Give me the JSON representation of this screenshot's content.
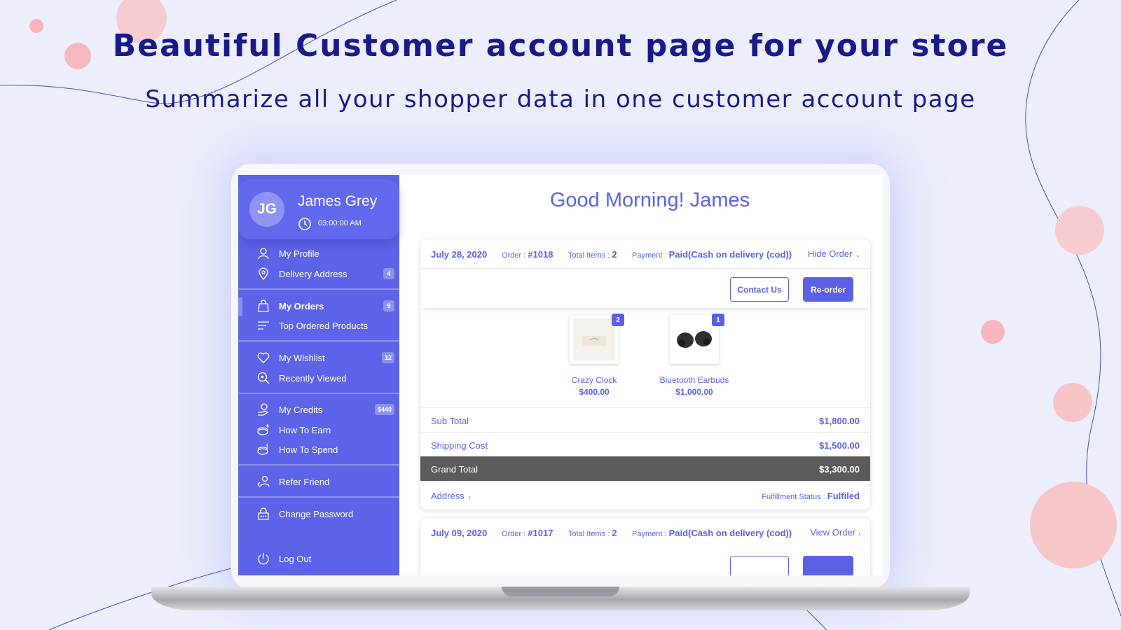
{
  "hero": {
    "title_prefix": "Beautiful ",
    "title_bold": "Customer account page",
    "title_suffix": " for your store",
    "subtitle": "Summarize all your shopper data in one customer account page"
  },
  "colors": {
    "accent": "#5b61e4",
    "sidebar": "#5c63e8",
    "page_bg": "#eceefc",
    "headline": "#181a8a",
    "grand_total_bg": "#5b5b5b"
  },
  "profile": {
    "initials": "JG",
    "name": "James Grey",
    "time": "03:00:00 AM",
    "time_icon": "clock-icon"
  },
  "sidebar": {
    "items": [
      {
        "label": "My Profile",
        "icon": "user-icon"
      },
      {
        "label": "Delivery Address",
        "icon": "location-pin-icon",
        "badge": "4"
      },
      {
        "label": "My Orders",
        "icon": "shopping-bag-icon",
        "badge": "9",
        "active": true
      },
      {
        "label": "Top Ordered Products",
        "icon": "sort-lines-icon"
      },
      {
        "label": "My Wishlist",
        "icon": "heart-icon",
        "badge": "12"
      },
      {
        "label": "Recently Viewed",
        "icon": "search-eye-icon"
      },
      {
        "label": "My Credits",
        "icon": "coin-hand-icon",
        "badge": "$440"
      },
      {
        "label": "How To Earn",
        "icon": "coins-plus-icon"
      },
      {
        "label": "How To Spend",
        "icon": "coins-dollar-icon"
      },
      {
        "label": "Refer Friend",
        "icon": "refer-friend-icon"
      },
      {
        "label": "Change Password",
        "icon": "lock-icon"
      },
      {
        "label": "Log Out",
        "icon": "power-icon"
      }
    ]
  },
  "main": {
    "greeting": "Good Morning! James",
    "orders": [
      {
        "date": "July 28, 2020",
        "order_label": "Order : ",
        "order_number": "#1018",
        "items_label": "Total Items : ",
        "items_count": "2",
        "payment_label": "Payment : ",
        "payment_value": "Paid(Cash on delivery (cod))",
        "toggle_label": "Hide Order",
        "contact_label": "Contact Us",
        "reorder_label": "Re-order",
        "products": [
          {
            "name": "Crazy Clock",
            "price": "$400.00",
            "qty": "2"
          },
          {
            "name": "Bluetooth Earbuds",
            "price": "$1,000.00",
            "qty": "1"
          }
        ],
        "sub_total_label": "Sub Total",
        "sub_total": "$1,800.00",
        "shipping_label": "Shipping Cost",
        "shipping": "$1,500.00",
        "grand_total_label": "Grand Total",
        "grand_total": "$3,300.00",
        "address_label": "Address",
        "fulfillment_label": "Fulfillment Status : ",
        "fulfillment_value": "Fulfiled"
      },
      {
        "date": "July 09, 2020",
        "order_label": "Order : ",
        "order_number": "#1017",
        "items_label": "Total Items : ",
        "items_count": "2",
        "payment_label": "Payment : ",
        "payment_value": "Paid(Cash on delivery (cod))",
        "toggle_label": "View Order"
      }
    ]
  }
}
